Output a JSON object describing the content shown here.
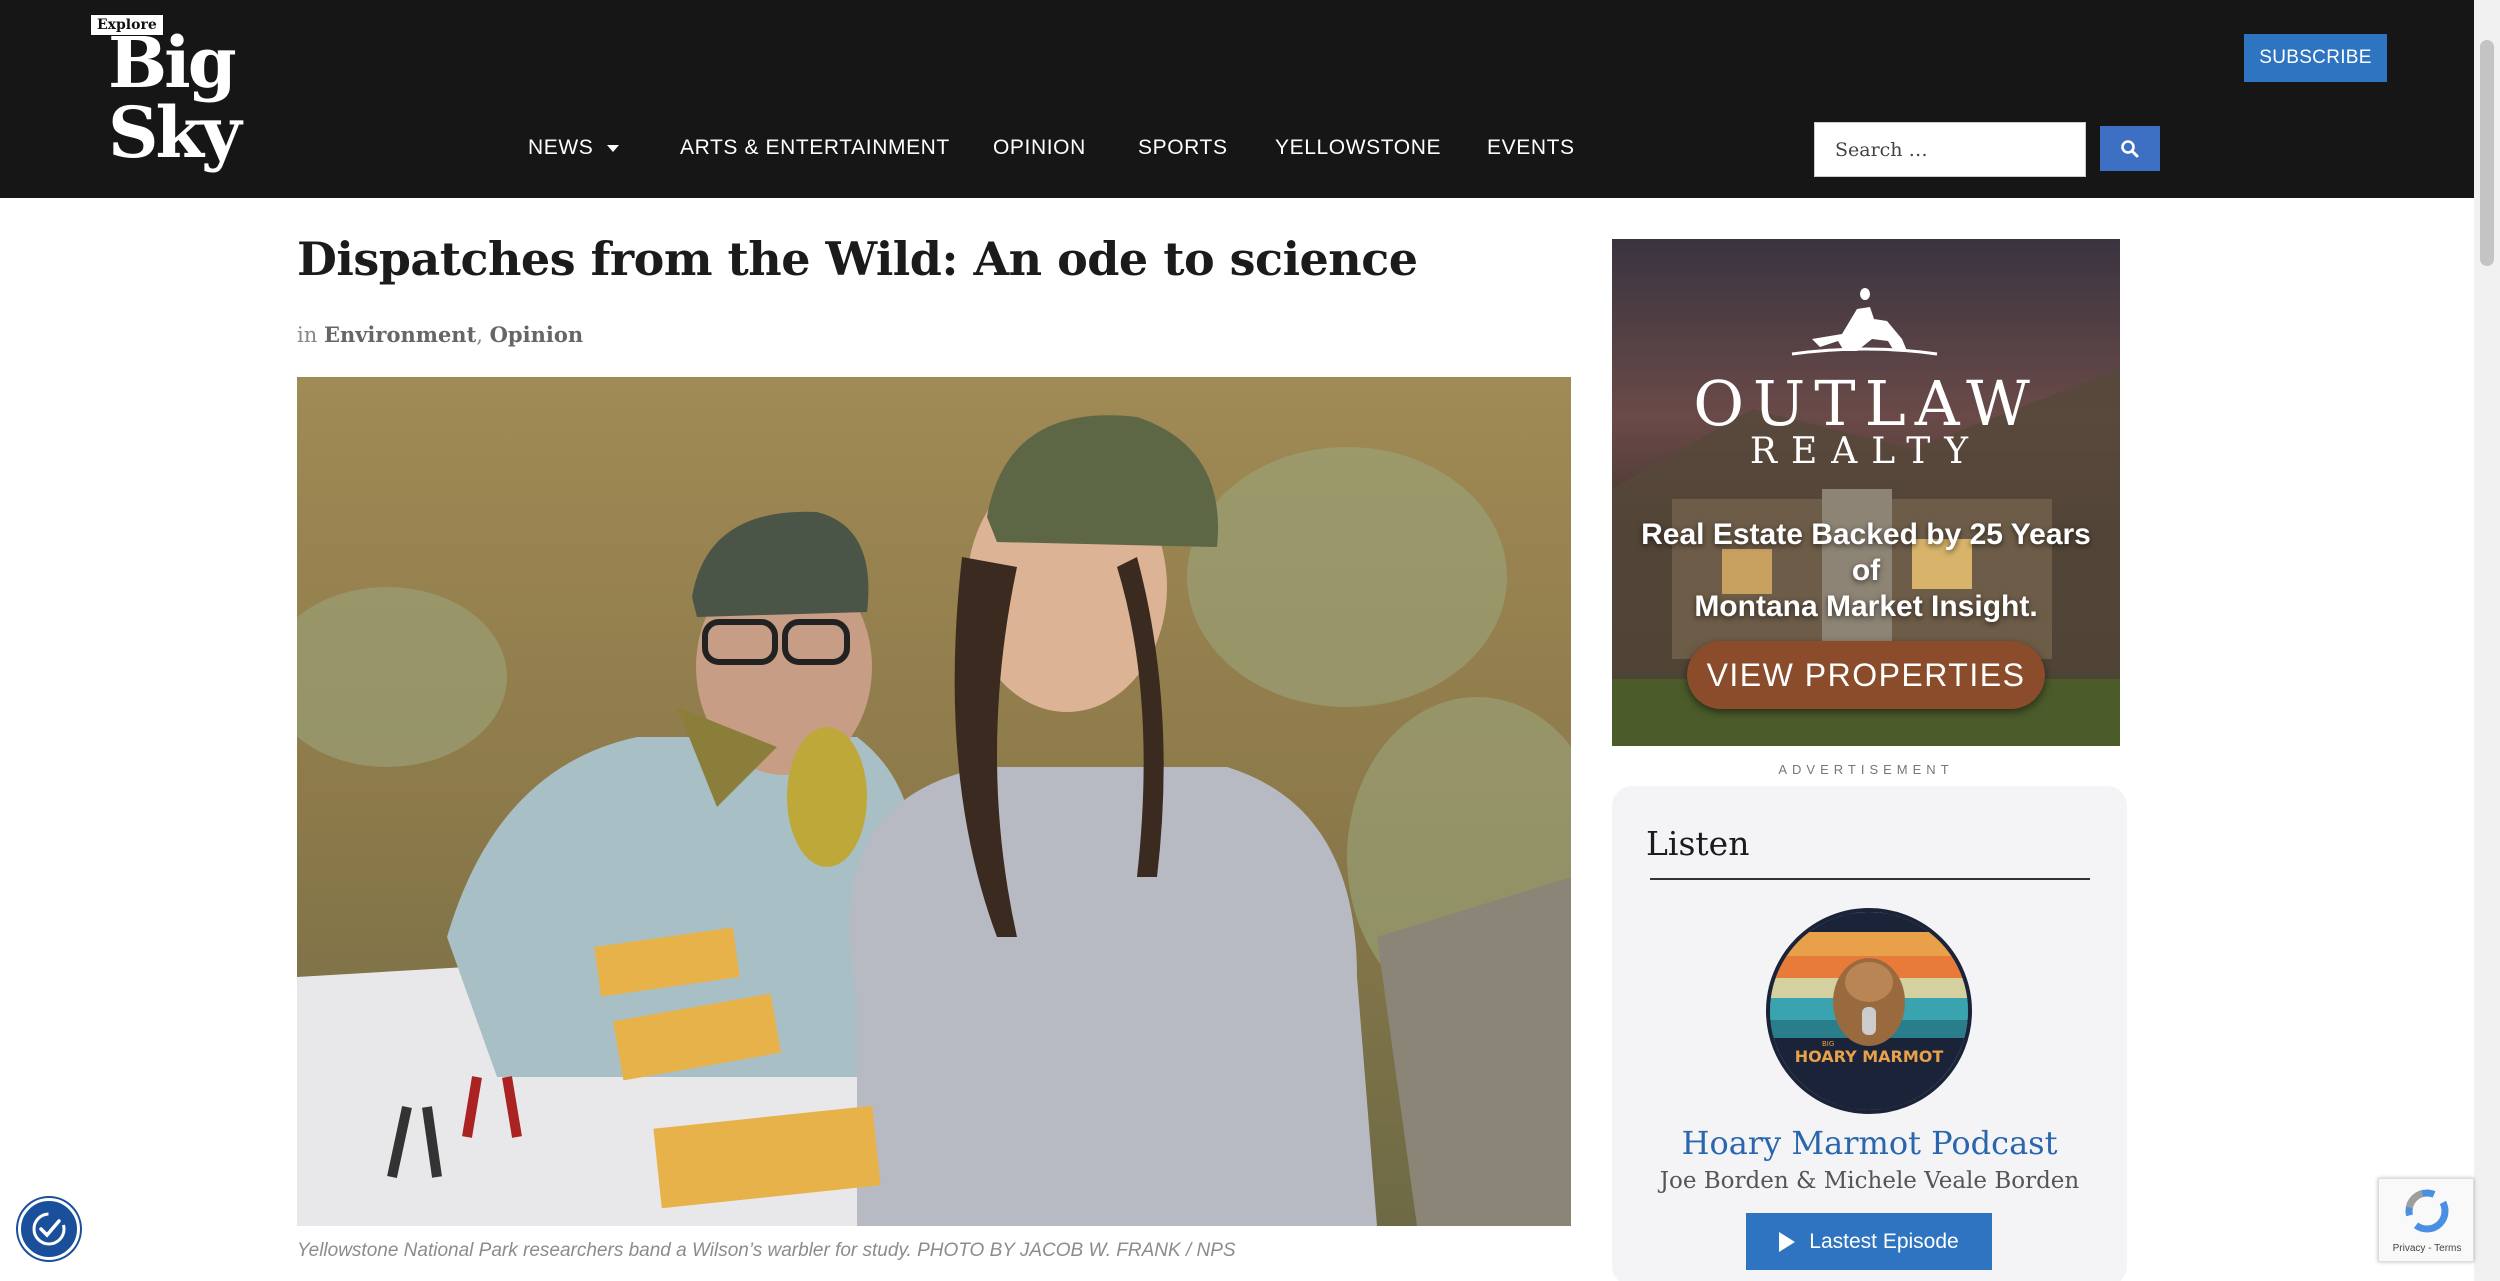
{
  "header": {
    "logo_small": "Explore",
    "logo_main": "Big Sky",
    "subscribe_label": "SUBSCRIBE",
    "nav": [
      {
        "label": "NEWS",
        "has_dropdown": true
      },
      {
        "label": "ARTS & ENTERTAINMENT"
      },
      {
        "label": "OPINION"
      },
      {
        "label": "SPORTS"
      },
      {
        "label": "YELLOWSTONE"
      },
      {
        "label": "EVENTS"
      }
    ],
    "search_placeholder": "Search …"
  },
  "article": {
    "title": "Dispatches from the Wild: An ode to science",
    "meta_prefix": "in",
    "categories": [
      "Environment",
      "Opinion"
    ],
    "photo_caption": "Yellowstone National Park researchers band a Wilson’s warbler for study. PHOTO BY JACOB W. FRANK / NPS"
  },
  "sidebar": {
    "ad": {
      "brand": "OUTLAW",
      "brand_sub": "REALTY",
      "tagline_line1": "Real Estate Backed by 25 Years of",
      "tagline_line2": "Montana Market Insight.",
      "button": "VIEW PROPERTIES",
      "label": "ADVERTISEMENT"
    },
    "listen": {
      "title": "Listen",
      "art_text": "HOARY MARMOT",
      "art_small": "BIG",
      "podcast_name": "Hoary Marmot Podcast",
      "hosts": "Joe Borden & Michele Veale Borden",
      "button": "Lastest Episode"
    }
  },
  "widgets": {
    "recaptcha_links": "Privacy - Terms"
  },
  "colors": {
    "header_bg": "#161616",
    "accent_blue": "#2f74c0",
    "link_blue": "#2a66ad",
    "ad_button": "#8a4c2a"
  }
}
